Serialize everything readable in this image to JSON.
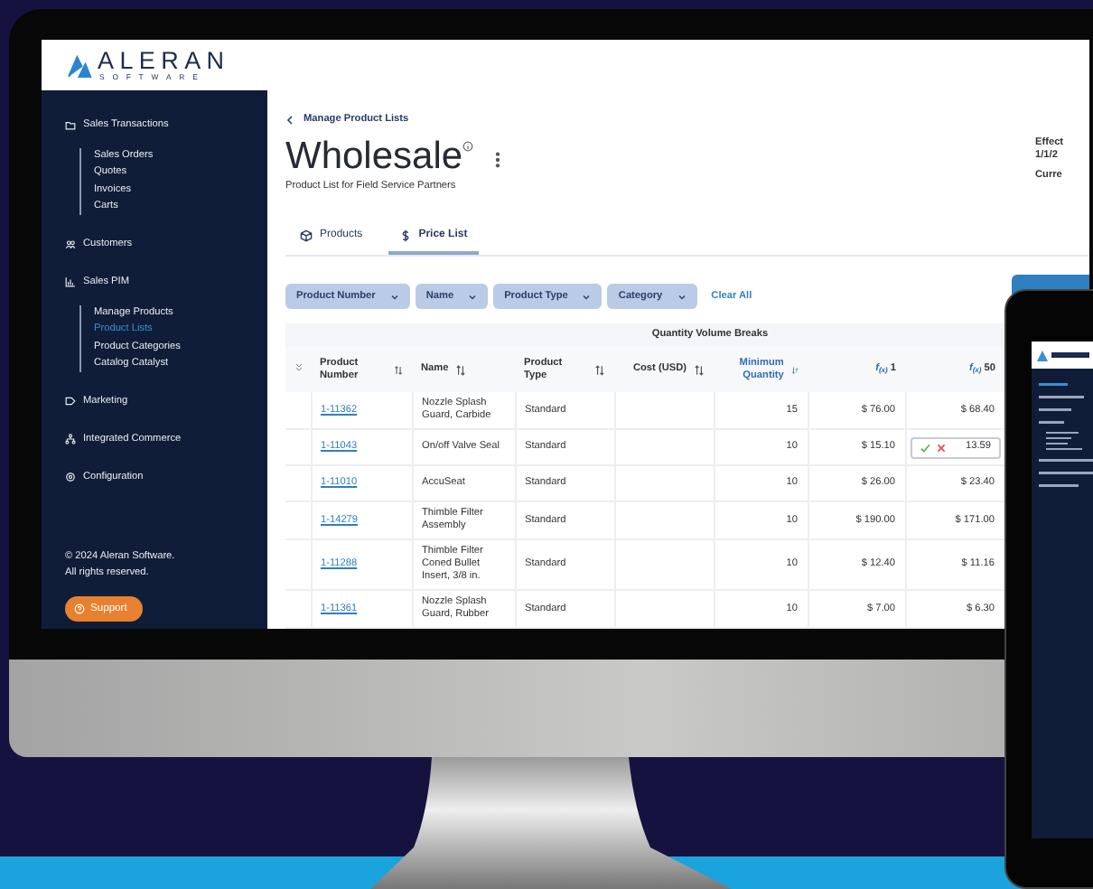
{
  "logo": {
    "wordmark": "ALERAN",
    "tagline": "SOFTWARE"
  },
  "sidebar": {
    "sections": [
      {
        "label": "Sales Transactions",
        "children": [
          {
            "label": "Sales Orders",
            "selected": false
          },
          {
            "label": "Quotes",
            "selected": false
          },
          {
            "label": "Invoices",
            "selected": false
          },
          {
            "label": "Carts",
            "selected": false
          }
        ]
      },
      {
        "label": "Customers"
      },
      {
        "label": "Sales PIM",
        "children": [
          {
            "label": "Manage Products",
            "selected": false
          },
          {
            "label": "Product Lists",
            "selected": true
          },
          {
            "label": "Product Categories",
            "selected": false
          },
          {
            "label": "Catalog Catalyst",
            "selected": false
          }
        ]
      },
      {
        "label": "Marketing"
      },
      {
        "label": "Integrated Commerce"
      },
      {
        "label": "Configuration"
      }
    ],
    "copyright": "© 2024 Aleran Software.\nAll rights reserved.",
    "support_button": "Support"
  },
  "breadcrumb": "Manage Product Lists",
  "page": {
    "title": "Wholesale",
    "subtitle": "Product List for Field Service Partners"
  },
  "details": [
    "Effect",
    "1/1/2",
    "Curre"
  ],
  "tabs": [
    {
      "label": "Products",
      "selected": false
    },
    {
      "label": "Price List",
      "selected": true
    }
  ],
  "filters": [
    "Product Number",
    "Name",
    "Product Type",
    "Category"
  ],
  "clear_all": "Clear All",
  "table": {
    "group_header": "Quantity Volume Breaks",
    "columns": [
      {
        "kind": "text",
        "label": "Product Number",
        "sorted": false
      },
      {
        "kind": "text",
        "label": "Name",
        "sorted": false
      },
      {
        "kind": "text",
        "label": "Product Type",
        "sorted": false
      },
      {
        "kind": "text",
        "label": "Cost (USD)",
        "sorted": false
      },
      {
        "kind": "text",
        "label": "Minimum Quantity",
        "sorted": true
      },
      {
        "kind": "tier",
        "prefix": "f$_{(x)}$",
        "label": "1"
      },
      {
        "kind": "tier",
        "prefix": "f$_{(x)}$",
        "label": "50"
      }
    ],
    "rows": [
      {
        "product_number": "1-11362",
        "name": "Nozzle Splash Guard, Carbide",
        "product_type": "Standard",
        "minimum_quantity": "15",
        "tier_prices": [
          {
            "text": "$ 76.00",
            "editing": false
          },
          {
            "text": "$ 68.40",
            "editing": false
          }
        ]
      },
      {
        "product_number": "1-11043",
        "name": "On/off Valve Seal",
        "product_type": "Standard",
        "minimum_quantity": "10",
        "tier_prices": [
          {
            "text": "$ 15.10",
            "editing": false
          },
          {
            "text": "13.59",
            "editing": true
          }
        ]
      },
      {
        "product_number": "1-11010",
        "name": "AccuSeat",
        "product_type": "Standard",
        "minimum_quantity": "10",
        "tier_prices": [
          {
            "text": "$ 26.00",
            "editing": false
          },
          {
            "text": "$ 23.40",
            "editing": false
          }
        ]
      },
      {
        "product_number": "1-14279",
        "name": "Thimble Filter Assembly",
        "product_type": "Standard",
        "minimum_quantity": "10",
        "tier_prices": [
          {
            "text": "$ 190.00",
            "editing": false
          },
          {
            "text": "$ 171.00",
            "editing": false
          }
        ]
      },
      {
        "product_number": "1-11288",
        "name": "Thimble Filter Coned Bullet Insert, 3/8 in.",
        "product_type": "Standard",
        "minimum_quantity": "10",
        "tier_prices": [
          {
            "text": "$ 12.40",
            "editing": false
          },
          {
            "text": "$ 11.16",
            "editing": false
          }
        ]
      },
      {
        "product_number": "1-11361",
        "name": "Nozzle Splash Guard, Rubber",
        "product_type": "Standard",
        "minimum_quantity": "10",
        "tier_prices": [
          {
            "text": "$ 7.00",
            "editing": false
          },
          {
            "text": "$ 6.30",
            "editing": false
          }
        ]
      }
    ]
  }
}
